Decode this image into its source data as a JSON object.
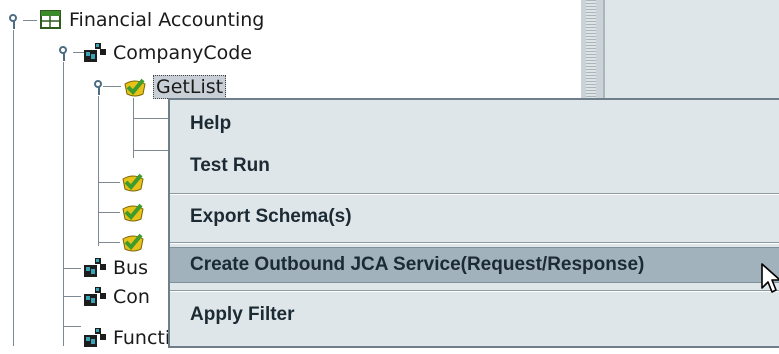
{
  "tree": {
    "root_label": "Financial Accounting",
    "company_label": "CompanyCode",
    "method_label": "GetList",
    "other_nodes": [
      "Bus",
      "Con",
      "FunctionalArea"
    ]
  },
  "context_menu": {
    "items": [
      {
        "label": "Help"
      },
      {
        "label": "Test Run"
      },
      {
        "label": "Export Schema(s)"
      },
      {
        "label": "Create Outbound JCA Service(Request/Response)"
      },
      {
        "label": "Apply Filter"
      }
    ],
    "highlighted_index": 3
  },
  "colors": {
    "menu_bg": "#dfe6ea",
    "menu_highlight": "#a1b2bd",
    "check_green": "#3e9b2c",
    "check_yellow": "#e8c218"
  },
  "icons": [
    "tree-handle-icon",
    "table-icon",
    "business-object-icon",
    "method-check-icon",
    "pointer-cursor-icon"
  ]
}
